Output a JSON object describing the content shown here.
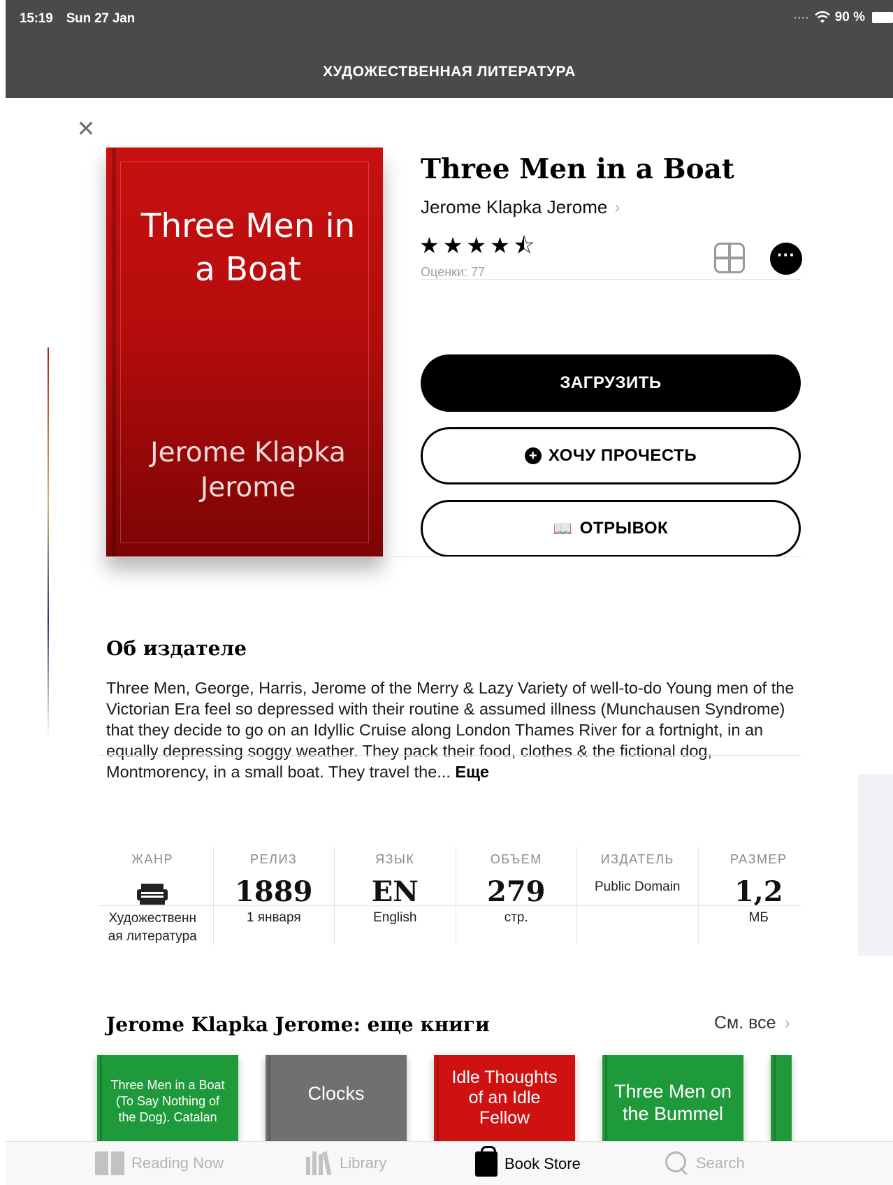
{
  "status_bar": {
    "time": "15:19",
    "date": "Sun 27 Jan",
    "battery": "90 %"
  },
  "header": {
    "category": "ХУДОЖЕСТВЕННАЯ ЛИТЕРАТУРА"
  },
  "book": {
    "cover_title": "Three Men in a Boat",
    "cover_author": "Jerome Klapka Jerome",
    "title": "Three Men in a Boat",
    "author": "Jerome Klapka Jerome",
    "stars": "★★★★⯪",
    "rating_value": 4.5,
    "ratings_count_label": "Оценки: 77"
  },
  "actions": {
    "download": "ЗАГРУЗИТЬ",
    "want_to_read": "ХОЧУ ПРОЧЕСТЬ",
    "sample": "ОТРЫВОК"
  },
  "about": {
    "title": "Об издателе",
    "text": "Three Men, George, Harris, Jerome of the Merry & Lazy Variety of well-to-do Young men of the Victorian Era feel so depressed with their routine & assumed illness (Munchausen Syndrome) that they decide to go on an Idyllic Cruise along London Thames River for a fortnight, in an equally depressing soggy weather. They pack their food, clothes & the fictional dog, Montmorency, in a small boat. They travel the...",
    "more": "Еще"
  },
  "info": {
    "genre": {
      "label": "ЖАНР",
      "value_line1": "Художественн",
      "value_line2": "ая литература",
      "icon": "typewriter-icon"
    },
    "release": {
      "label": "РЕЛИЗ",
      "value": "1889",
      "sub": "1 января"
    },
    "language": {
      "label": "ЯЗЫК",
      "value": "EN",
      "sub": "English"
    },
    "length": {
      "label": "ОБЪЕМ",
      "value": "279",
      "sub": "стр."
    },
    "publisher": {
      "label": "ИЗДАТЕЛЬ",
      "value": "Public Domain"
    },
    "size": {
      "label": "РАЗМЕР",
      "value": "1,2",
      "sub": "МБ"
    }
  },
  "more_books": {
    "title": "Jerome Klapka Jerome: еще книги",
    "see_all": "См. все",
    "items": [
      {
        "title": "Three Men in a Boat (To Say Nothing of the Dog). Catalan",
        "color": "#1f9a3a"
      },
      {
        "title": "Clocks",
        "color": "#707070"
      },
      {
        "title": "Idle Thoughts of an Idle Fellow",
        "color": "#d01111"
      },
      {
        "title": "Three Men on the Bummel",
        "color": "#1f9a3a"
      }
    ]
  },
  "tabbar": {
    "reading_now": "Reading Now",
    "library": "Library",
    "book_store": "Book Store",
    "search": "Search",
    "active": "Book Store"
  },
  "colors": {
    "header_bg": "#4a4a4a",
    "cover_red": "#c81010",
    "button_black": "#000000"
  }
}
